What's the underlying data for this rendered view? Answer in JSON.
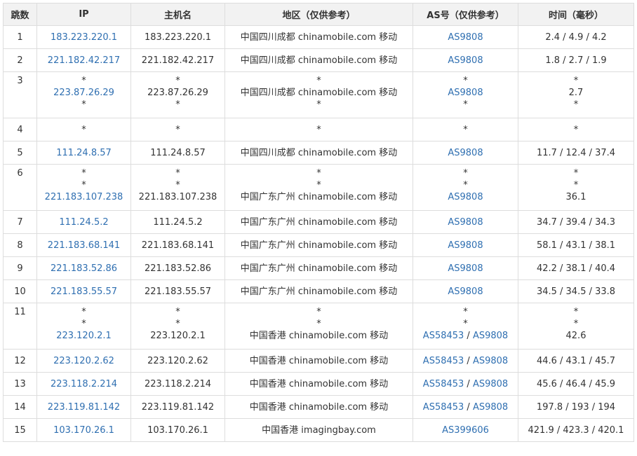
{
  "headers": [
    "跳数",
    "IP",
    "主机名",
    "地区（仅供参考）",
    "AS号（仅供参考）",
    "时间（毫秒）"
  ],
  "rows": [
    {
      "hop": "1",
      "ip": [
        "183.223.220.1"
      ],
      "host": [
        "183.223.220.1"
      ],
      "region": [
        "中国四川成都 chinamobile.com 移动"
      ],
      "as": [
        [
          "AS9808"
        ]
      ],
      "time": [
        "2.4 / 4.9 / 4.2"
      ]
    },
    {
      "hop": "2",
      "ip": [
        "221.182.42.217"
      ],
      "host": [
        "221.182.42.217"
      ],
      "region": [
        "中国四川成都 chinamobile.com 移动"
      ],
      "as": [
        [
          "AS9808"
        ]
      ],
      "time": [
        "1.8 / 2.7 / 1.9"
      ]
    },
    {
      "hop": "3",
      "ip": [
        "*",
        "223.87.26.29",
        "*"
      ],
      "host": [
        "*",
        "223.87.26.29",
        "*"
      ],
      "region": [
        "*",
        "中国四川成都 chinamobile.com 移动",
        "*"
      ],
      "as": [
        [
          "*"
        ],
        [
          "AS9808"
        ],
        [
          "*"
        ]
      ],
      "time": [
        "*",
        "2.7",
        "*"
      ]
    },
    {
      "hop": "4",
      "ip": [
        "*"
      ],
      "host": [
        "*"
      ],
      "region": [
        "*"
      ],
      "as": [
        [
          "*"
        ]
      ],
      "time": [
        "*"
      ]
    },
    {
      "hop": "5",
      "ip": [
        "111.24.8.57"
      ],
      "host": [
        "111.24.8.57"
      ],
      "region": [
        "中国四川成都 chinamobile.com 移动"
      ],
      "as": [
        [
          "AS9808"
        ]
      ],
      "time": [
        "11.7 / 12.4 / 37.4"
      ]
    },
    {
      "hop": "6",
      "ip": [
        "*",
        "*",
        "221.183.107.238"
      ],
      "host": [
        "*",
        "*",
        "221.183.107.238"
      ],
      "region": [
        "*",
        "*",
        "中国广东广州 chinamobile.com 移动"
      ],
      "as": [
        [
          "*"
        ],
        [
          "*"
        ],
        [
          "AS9808"
        ]
      ],
      "time": [
        "*",
        "*",
        "36.1"
      ]
    },
    {
      "hop": "7",
      "ip": [
        "111.24.5.2"
      ],
      "host": [
        "111.24.5.2"
      ],
      "region": [
        "中国广东广州 chinamobile.com 移动"
      ],
      "as": [
        [
          "AS9808"
        ]
      ],
      "time": [
        "34.7 / 39.4 / 34.3"
      ]
    },
    {
      "hop": "8",
      "ip": [
        "221.183.68.141"
      ],
      "host": [
        "221.183.68.141"
      ],
      "region": [
        "中国广东广州 chinamobile.com 移动"
      ],
      "as": [
        [
          "AS9808"
        ]
      ],
      "time": [
        "58.1 / 43.1 / 38.1"
      ]
    },
    {
      "hop": "9",
      "ip": [
        "221.183.52.86"
      ],
      "host": [
        "221.183.52.86"
      ],
      "region": [
        "中国广东广州 chinamobile.com 移动"
      ],
      "as": [
        [
          "AS9808"
        ]
      ],
      "time": [
        "42.2 / 38.1 / 40.4"
      ]
    },
    {
      "hop": "10",
      "ip": [
        "221.183.55.57"
      ],
      "host": [
        "221.183.55.57"
      ],
      "region": [
        "中国广东广州 chinamobile.com 移动"
      ],
      "as": [
        [
          "AS9808"
        ]
      ],
      "time": [
        "34.5 / 34.5 / 33.8"
      ]
    },
    {
      "hop": "11",
      "ip": [
        "*",
        "*",
        "223.120.2.1"
      ],
      "host": [
        "*",
        "*",
        "223.120.2.1"
      ],
      "region": [
        "*",
        "*",
        "中国香港 chinamobile.com 移动"
      ],
      "as": [
        [
          "*"
        ],
        [
          "*"
        ],
        [
          "AS58453",
          "AS9808"
        ]
      ],
      "time": [
        "*",
        "*",
        "42.6"
      ]
    },
    {
      "hop": "12",
      "ip": [
        "223.120.2.62"
      ],
      "host": [
        "223.120.2.62"
      ],
      "region": [
        "中国香港 chinamobile.com 移动"
      ],
      "as": [
        [
          "AS58453",
          "AS9808"
        ]
      ],
      "time": [
        "44.6 / 43.1 / 45.7"
      ]
    },
    {
      "hop": "13",
      "ip": [
        "223.118.2.214"
      ],
      "host": [
        "223.118.2.214"
      ],
      "region": [
        "中国香港 chinamobile.com 移动"
      ],
      "as": [
        [
          "AS58453",
          "AS9808"
        ]
      ],
      "time": [
        "45.6 / 46.4 / 45.9"
      ]
    },
    {
      "hop": "14",
      "ip": [
        "223.119.81.142"
      ],
      "host": [
        "223.119.81.142"
      ],
      "region": [
        "中国香港 chinamobile.com 移动"
      ],
      "as": [
        [
          "AS58453",
          "AS9808"
        ]
      ],
      "time": [
        "197.8 / 193 / 194"
      ]
    },
    {
      "hop": "15",
      "ip": [
        "103.170.26.1"
      ],
      "host": [
        "103.170.26.1"
      ],
      "region": [
        "中国香港 imagingbay.com"
      ],
      "as": [
        [
          "AS399606"
        ]
      ],
      "time": [
        "421.9 / 423.3 / 420.1"
      ]
    }
  ],
  "colors": {
    "link": "#2f6fb1",
    "text": "#333333",
    "border": "#dddddd",
    "header_bg": "#f2f2f2"
  }
}
